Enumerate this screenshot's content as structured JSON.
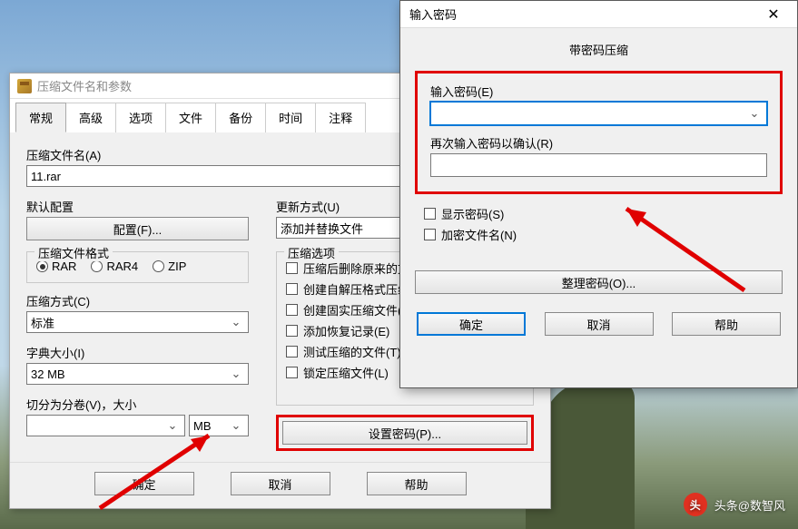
{
  "mainDialog": {
    "title": "压缩文件名和参数",
    "tabs": [
      "常规",
      "高级",
      "选项",
      "文件",
      "备份",
      "时间",
      "注释"
    ],
    "archiveNameLabel": "压缩文件名(A)",
    "archiveName": "11.rar",
    "defaultProfileLabel": "默认配置",
    "profileButton": "配置(F)...",
    "updateModeLabel": "更新方式(U)",
    "updateMode": "添加并替换文件",
    "formatLabel": "压缩文件格式",
    "formats": [
      "RAR",
      "RAR4",
      "ZIP"
    ],
    "methodLabel": "压缩方式(C)",
    "method": "标准",
    "dictLabel": "字典大小(I)",
    "dict": "32 MB",
    "splitLabel": "切分为分卷(V)，大小",
    "splitValue": "",
    "splitUnit": "MB",
    "optionsLabel": "压缩选项",
    "options": [
      "压缩后删除原来的文",
      "创建自解压格式压缩",
      "创建固实压缩文件()",
      "添加恢复记录(E)",
      "测试压缩的文件(T)",
      "锁定压缩文件(L)"
    ],
    "setPasswordButton": "设置密码(P)...",
    "ok": "确定",
    "cancel": "取消",
    "help": "帮助"
  },
  "pwDialog": {
    "title": "输入密码",
    "subtitle": "带密码压缩",
    "enterLabel": "输入密码(E)",
    "confirmLabel": "再次输入密码以确认(R)",
    "showPassword": "显示密码(S)",
    "encryptNames": "加密文件名(N)",
    "manageButton": "整理密码(O)...",
    "ok": "确定",
    "cancel": "取消",
    "help": "帮助"
  },
  "watermark": "头条@数智风"
}
